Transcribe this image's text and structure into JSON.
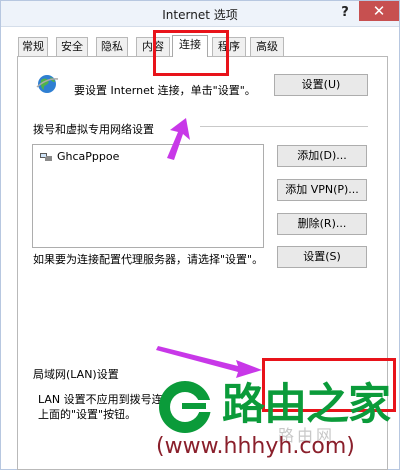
{
  "window": {
    "title": "Internet 选项",
    "help": "?",
    "close": "✕"
  },
  "tabs": [
    {
      "label": "常规"
    },
    {
      "label": "安全"
    },
    {
      "label": "隐私"
    },
    {
      "label": "内容"
    },
    {
      "label": "连接",
      "active": true
    },
    {
      "label": "程序"
    },
    {
      "label": "高级"
    }
  ],
  "setup": {
    "text": "要设置 Internet 连接，单击\"设置\"。",
    "button": "设置(U)",
    "icon": "globe-icon"
  },
  "vpn": {
    "title": "拨号和虚拟专用网络设置",
    "items": [
      {
        "label": "GhcaPppoe",
        "icon": "network-connection-icon"
      }
    ],
    "add": "添加(D)...",
    "add_vpn": "添加 VPN(P)...",
    "remove": "删除(R)...",
    "settings": "设置(S)",
    "proxy_text": "如果要为连接配置代理服务器，请选择\"设置\"。"
  },
  "lan": {
    "title": "局域网(LAN)设置",
    "line1": "LAN 设置不应用到拨号连",
    "line2": "上面的\"设置\"按钮。"
  },
  "brand": {
    "name": "路由之家",
    "site": "(www.hhhyh.com)",
    "watermark": "路由网",
    "color": "#0b9b3a"
  },
  "annotations": {
    "highlight_color": "#e8131a",
    "arrow_color": "#c838e8"
  }
}
